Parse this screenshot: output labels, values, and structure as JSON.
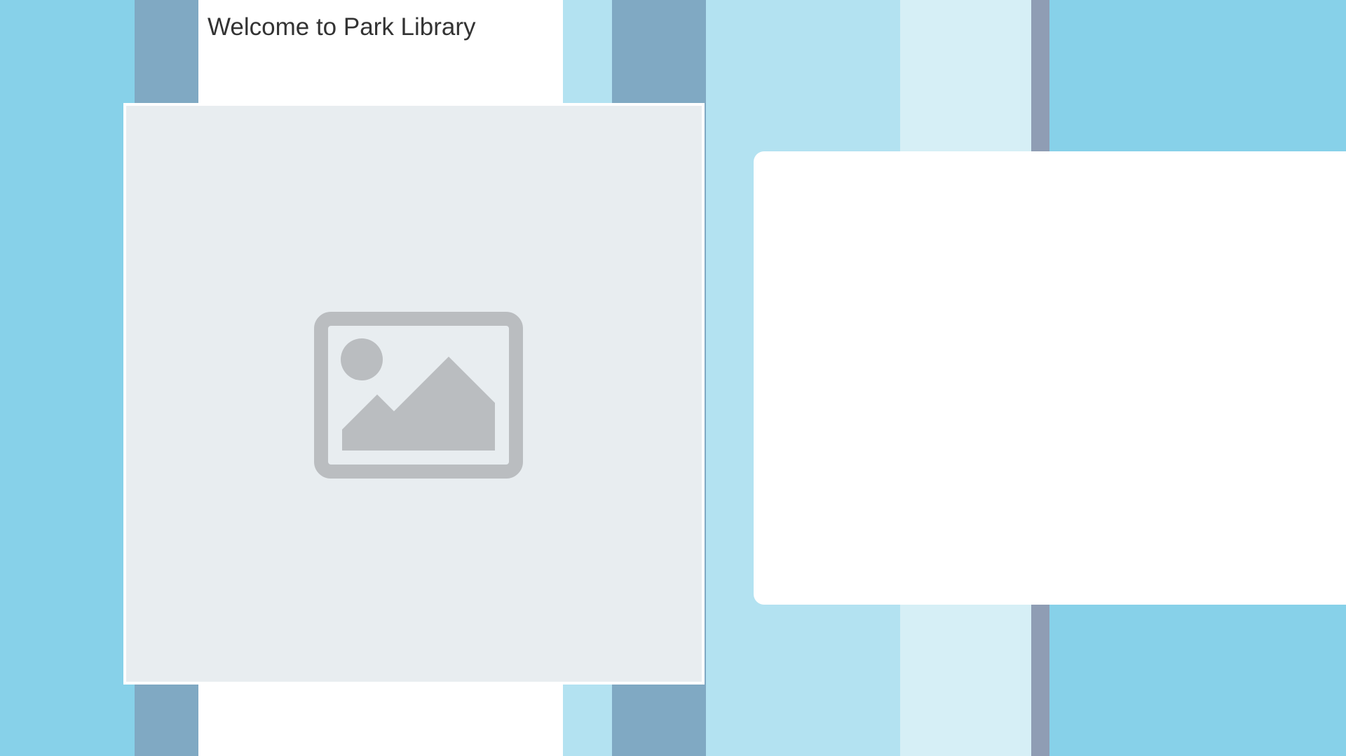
{
  "header": {
    "title": "Welcome to Park Library"
  },
  "hero": {
    "image_icon": "image-placeholder-icon"
  },
  "colors": {
    "sky_blue": "#87d1e9",
    "steel_blue": "#80a9c3",
    "light_blue": "#b3e2f1",
    "pale_blue": "#d6eff6",
    "slate": "#8f9db4",
    "placeholder_bg": "#e8edf0",
    "placeholder_icon": "#babdc0",
    "heading_text": "#333333"
  }
}
